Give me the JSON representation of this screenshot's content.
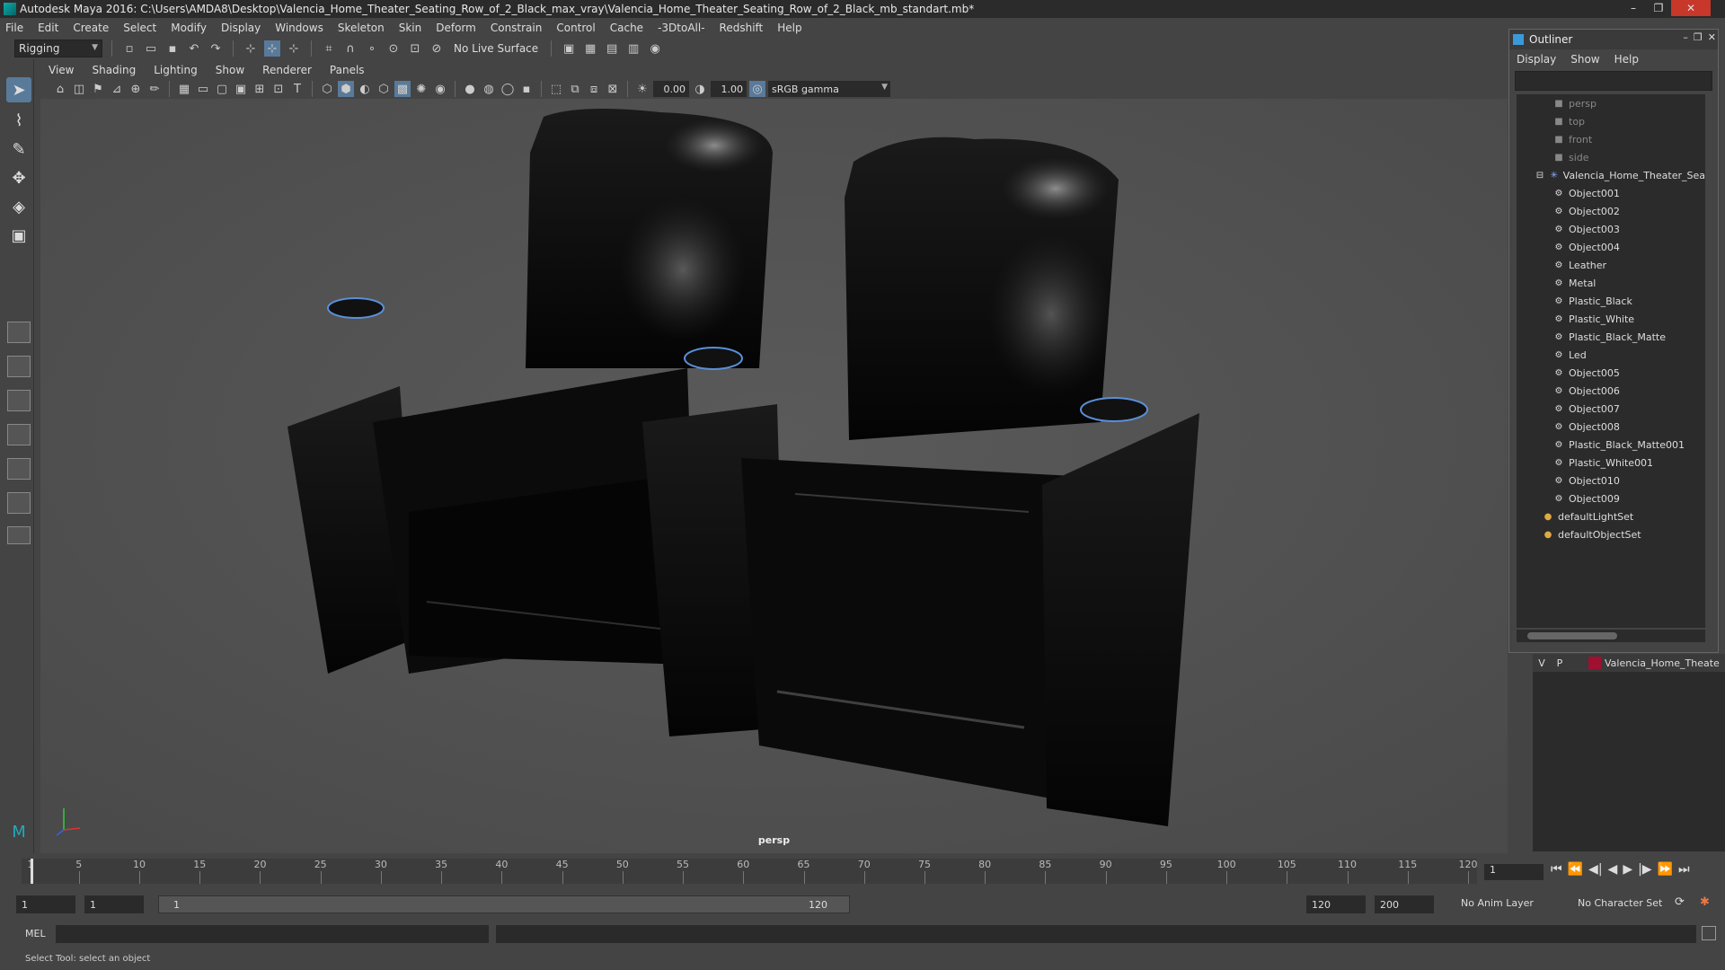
{
  "window": {
    "title": "Autodesk Maya 2016: C:\\Users\\AMDA8\\Desktop\\Valencia_Home_Theater_Seating_Row_of_2_Black_max_vray\\Valencia_Home_Theater_Seating_Row_of_2_Black_mb_standart.mb*",
    "controls": [
      "–",
      "❐",
      "✕"
    ]
  },
  "menubar": [
    "File",
    "Edit",
    "Create",
    "Select",
    "Modify",
    "Display",
    "Windows",
    "Skeleton",
    "Skin",
    "Deform",
    "Constrain",
    "Control",
    "Cache",
    "-3DtoAll-",
    "Redshift",
    "Help"
  ],
  "shelf": {
    "mode": "Rigging",
    "live_surface": "No Live Surface"
  },
  "panel": {
    "menu": [
      "View",
      "Shading",
      "Lighting",
      "Show",
      "Renderer",
      "Panels"
    ],
    "exposure": "0.00",
    "gamma": "1.00",
    "color_space": "sRGB gamma",
    "camera_label": "persp"
  },
  "outliner": {
    "title": "Outliner",
    "menu": [
      "Display",
      "Show",
      "Help"
    ],
    "cameras": [
      "persp",
      "top",
      "front",
      "side"
    ],
    "group": "Valencia_Home_Theater_Sea",
    "children": [
      "Object001",
      "Object002",
      "Object003",
      "Object004",
      "Leather",
      "Metal",
      "Plastic_Black",
      "Plastic_White",
      "Plastic_Black_Matte",
      "Led",
      "Object005",
      "Object006",
      "Object007",
      "Object008",
      "Plastic_Black_Matte001",
      "Plastic_White001",
      "Object010",
      "Object009"
    ],
    "sets": [
      "defaultLightSet",
      "defaultObjectSet"
    ]
  },
  "layers": {
    "v": "V",
    "p": "P",
    "name": "Valencia_Home_Theate",
    "color": "#a01030"
  },
  "timeline": {
    "ticks": [
      "1",
      "5",
      "10",
      "15",
      "20",
      "25",
      "30",
      "35",
      "40",
      "45",
      "50",
      "55",
      "60",
      "65",
      "70",
      "75",
      "80",
      "85",
      "90",
      "95",
      "100",
      "105",
      "110",
      "115",
      "120"
    ],
    "current_frame": "1"
  },
  "range": {
    "start": "1",
    "playback_start": "1",
    "slider_start": "1",
    "slider_end": "120",
    "playback_end": "120",
    "end": "200",
    "anim_layer": "No Anim Layer",
    "character_set": "No Character Set"
  },
  "cmdline": {
    "label": "MEL"
  },
  "helpline": {
    "text": "Select Tool: select an object"
  }
}
